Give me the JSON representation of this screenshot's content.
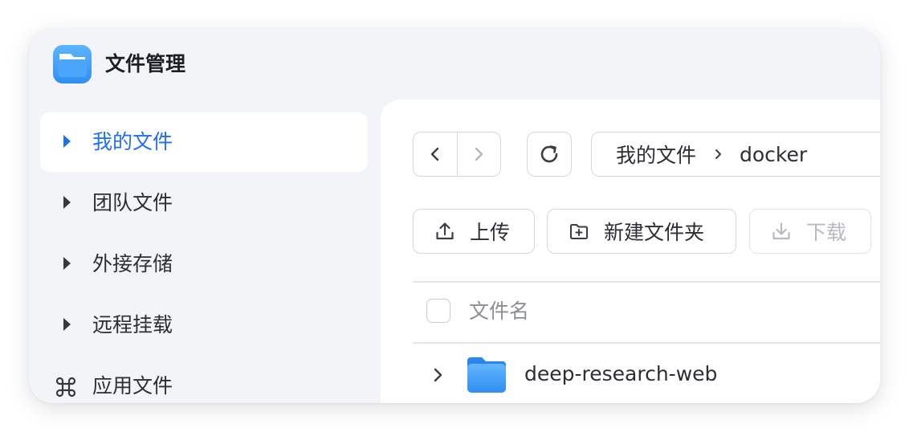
{
  "app": {
    "title": "文件管理",
    "icon": "folder-app-icon"
  },
  "sidebar": {
    "items": [
      {
        "label": "我的文件",
        "icon": "caret-right-icon",
        "active": true
      },
      {
        "label": "团队文件",
        "icon": "caret-right-icon",
        "active": false
      },
      {
        "label": "外接存储",
        "icon": "caret-right-icon",
        "active": false
      },
      {
        "label": "远程挂载",
        "icon": "caret-right-icon",
        "active": false
      },
      {
        "label": "应用文件",
        "icon": "command-icon",
        "active": false
      }
    ]
  },
  "toolbar": {
    "breadcrumb": [
      "我的文件",
      "docker"
    ],
    "upload_label": "上传",
    "new_folder_label": "新建文件夹",
    "download_label": "下载"
  },
  "list": {
    "header_name": "文件名",
    "rows": [
      {
        "name": "deep-research-web",
        "type": "folder"
      }
    ]
  },
  "colors": {
    "accent": "#1f6ff0",
    "folder_blue": "#3d9df5",
    "window_bg": "#f2f4f7"
  }
}
